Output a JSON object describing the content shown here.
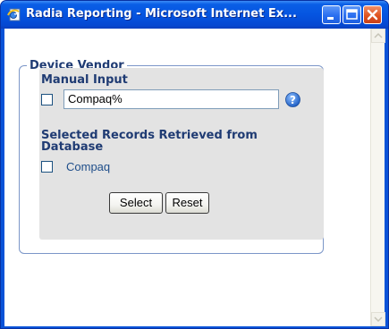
{
  "window": {
    "title": "Radia Reporting - Microsoft Internet Ex...",
    "icons": {
      "app": "ie-page-icon",
      "minimize": "minimize-icon",
      "maximize": "maximize-icon",
      "close": "close-icon"
    }
  },
  "colors": {
    "titlebar": "#0554e0",
    "panel_bg": "#e3e3e3",
    "legend_text": "#1f3b73",
    "record_link": "#1f4e8a",
    "help_icon": "#2d6fd1"
  },
  "form": {
    "legend": "Device Vendor",
    "manual_input_label": "Manual Input",
    "manual_input_value": "Compaq%",
    "manual_checkbox_checked": false,
    "selected_records_label": "Selected Records Retrieved from Database",
    "records": [
      {
        "label": "Compaq",
        "checked": false
      }
    ],
    "select_button": "Select",
    "reset_button": "Reset"
  }
}
